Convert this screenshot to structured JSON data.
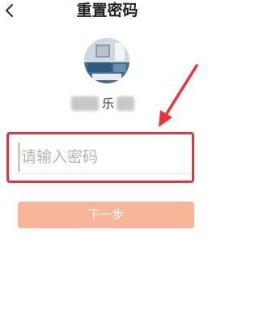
{
  "header": {
    "title": "重置密码",
    "back_icon": "back-arrow-icon"
  },
  "profile": {
    "avatar_icon": "profile-photo",
    "username_visible": "乐"
  },
  "password": {
    "placeholder": "请输入密码",
    "value": ""
  },
  "actions": {
    "next_label": "下一步"
  },
  "annotation": {
    "highlight_color": "#e8333a",
    "arrow_color": "#e8333a"
  },
  "colors": {
    "button_bg": "#f8b597",
    "title_text": "#222222"
  }
}
